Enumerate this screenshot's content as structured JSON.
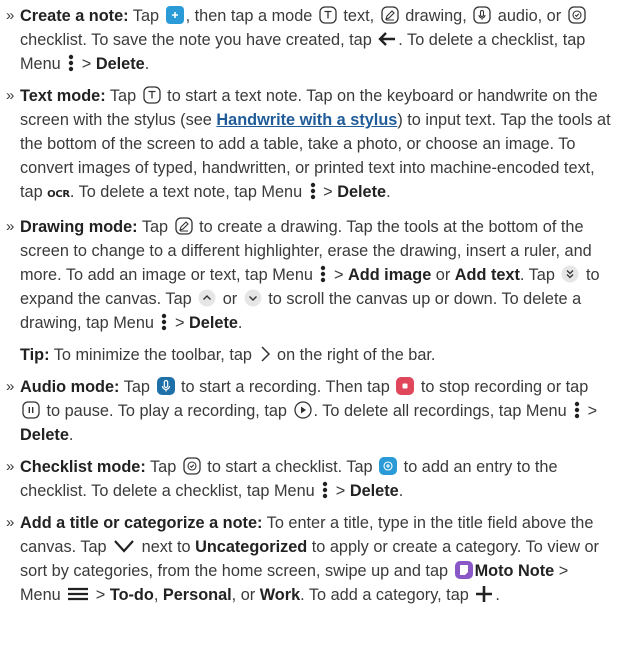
{
  "colors": {
    "text": "#3a3a3a",
    "link": "#1f5c99",
    "blue": "#2a9bd6",
    "red": "#e0475b",
    "purple": "#8a57c6"
  },
  "create": {
    "title": "Create a note:",
    "t1": " Tap ",
    "t2": ", then tap a mode ",
    "t3": " text, ",
    "t4": " drawing, ",
    "t5": " audio, or ",
    "t6": " checklist. To save the note you have created, tap ",
    "t7": ". To delete a checklist, tap Menu ",
    "t8": " > ",
    "delete": "Delete",
    "t9": "."
  },
  "text_mode": {
    "title": "Text mode:",
    "t1": " Tap ",
    "t2": " to start a text note. Tap on the keyboard or handwrite on the screen with the stylus (see ",
    "link": "Handwrite with a stylus",
    "t3": ") to input text. Tap the tools at the bottom of the screen to add a table, take a photo, or choose an image. To convert images of typed, handwritten, or printed text into machine-encoded text, tap ",
    "ocr": "OCR",
    "t4": ". To delete a text note, tap Menu ",
    "t5": " > ",
    "delete": "Delete",
    "t6": "."
  },
  "drawing_mode": {
    "title": "Drawing mode:",
    "t1": " Tap ",
    "t2": " to create a drawing. Tap the tools at the bottom of the screen to change to a different highlighter, erase the drawing, insert a ruler, and more. To add an image or text, tap Menu ",
    "t3": " > ",
    "add_image": "Add image",
    "t4": " or ",
    "add_text": "Add text",
    "t5": ". Tap ",
    "t6": " to expand the canvas. Tap ",
    "t7": " or ",
    "t8": " to scroll the canvas up or down. To delete a drawing, tap Menu ",
    "t9": " > ",
    "delete": "Delete",
    "t10": "."
  },
  "tip": {
    "title": "Tip:",
    "t1": " To minimize the toolbar, tap ",
    "t2": " on the right of the bar."
  },
  "audio_mode": {
    "title": "Audio mode:",
    "t1": " Tap ",
    "t2": " to start a recording. Then tap ",
    "t3": " to stop recording or tap ",
    "t4": " to pause. To play a recording, tap ",
    "t5": ". To delete all recordings, tap Menu ",
    "t6": " > ",
    "delete": "Delete",
    "t7": "."
  },
  "checklist_mode": {
    "title": "Checklist mode:",
    "t1": " Tap ",
    "t2": " to start a checklist. Tap ",
    "t3": " to add an entry to the checklist. To delete a checklist, tap Menu ",
    "t4": " > ",
    "delete": "Delete",
    "t5": "."
  },
  "title_cat": {
    "title": "Add a title or categorize a note:",
    "t1": " To enter a title, type in the title field above the canvas. Tap ",
    "t2": " next to ",
    "uncategorized": "Uncategorized",
    "t3": " to apply or create a category. To view or sort by categories, from the home screen, swipe up and tap ",
    "app": "Moto Note",
    "t4": " > Menu ",
    "t5": " > ",
    "todo": "To-do",
    "t6": ", ",
    "personal": "Personal",
    "t7": ", or ",
    "work": "Work",
    "t8": ". To add a category, tap ",
    "t9": "."
  },
  "bullet": "»"
}
